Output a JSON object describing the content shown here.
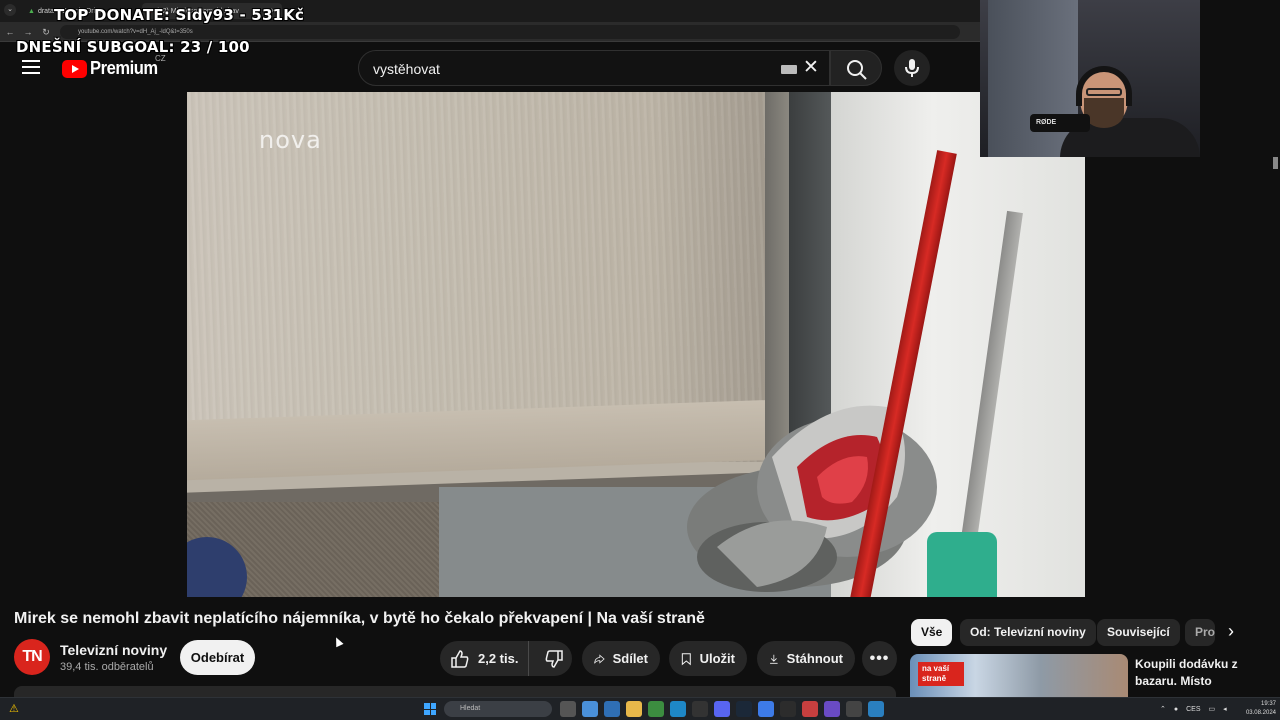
{
  "browser": {
    "tabs": [
      {
        "label": "drata – Google Drive"
      },
      {
        "label": "(52) Mirek se nemohl zbav"
      }
    ],
    "url": "youtube.com/watch?v=dH_Aj_-ldQ&t=350s"
  },
  "overlay": {
    "top_donate": "TOP DONATE: Sidy93 - 531Kč",
    "subgoal": "DNEŠNÍ SUBGOAL: 23 / 100"
  },
  "header": {
    "logo_text": "Premium",
    "country": "CZ",
    "search_value": "vystěhovat"
  },
  "video": {
    "watermark": "nova",
    "title": "Mirek se nemohl zbavit neplatícího nájemníka, v bytě ho čekalo překvapení | Na vaší straně",
    "webcam_mic_brand": "RØDE"
  },
  "channel": {
    "avatar_text": "TN",
    "name": "Televizní noviny",
    "subscribers": "39,4 tis. odběratelů",
    "subscribe_label": "Odebírat"
  },
  "actions": {
    "likes": "2,2 tis.",
    "share": "Sdílet",
    "save": "Uložit",
    "download": "Stáhnout",
    "more": "•••"
  },
  "recommendations": {
    "chips": [
      "Vše",
      "Od: Televizní noviny",
      "Související",
      "Pro"
    ],
    "first": {
      "badge": "na vaší straně",
      "title": "Koupili dodávku z bazaru. Místo"
    }
  },
  "taskbar": {
    "search_placeholder": "Hledat",
    "lang": "CES",
    "time": "19:37",
    "date": "03.08.2024"
  },
  "colors": {
    "background": "#0f0f0f",
    "youtube_red": "#ff0000",
    "channel_avatar": "#d9251d",
    "pill": "#272727"
  }
}
